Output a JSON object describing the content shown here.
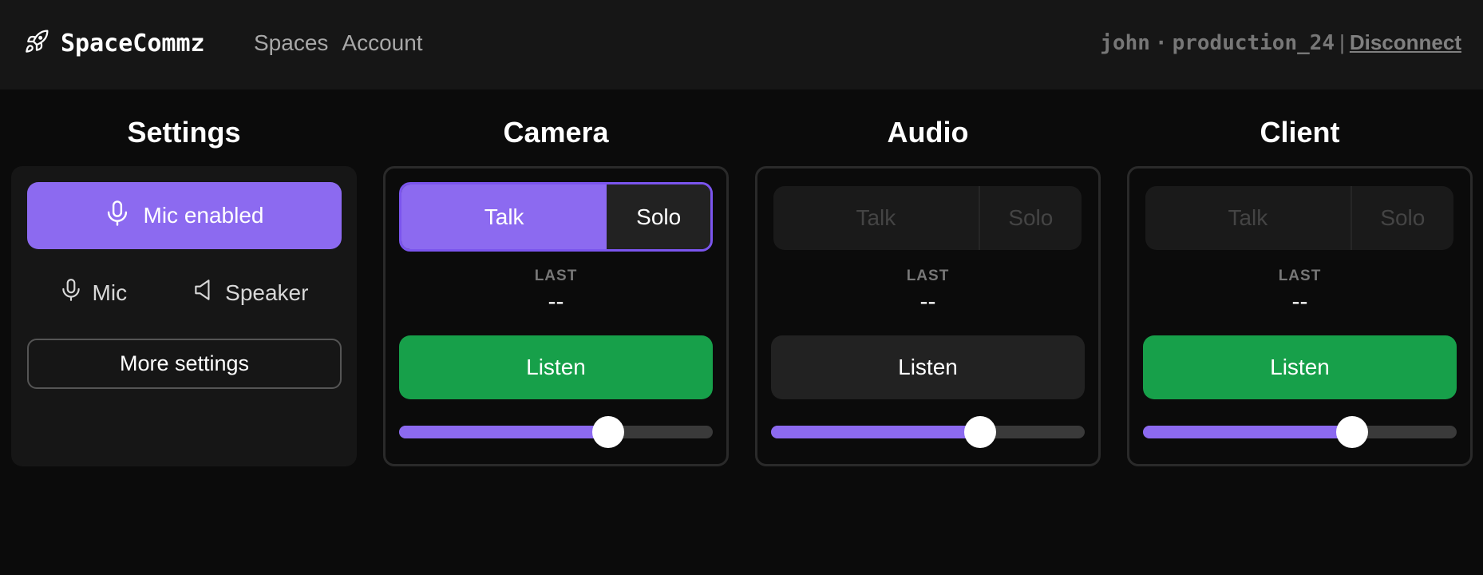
{
  "header": {
    "brand": "SpaceCommz",
    "nav": [
      "Spaces",
      "Account"
    ],
    "user": "john",
    "separator_dot": "·",
    "space": "production_24",
    "divider": "|",
    "disconnect_label": "Disconnect"
  },
  "settings": {
    "title": "Settings",
    "mic_enabled_label": "Mic enabled",
    "mic_label": "Mic",
    "speaker_label": "Speaker",
    "more_settings_label": "More settings"
  },
  "channels": [
    {
      "title": "Camera",
      "talk_label": "Talk",
      "solo_label": "Solo",
      "talk_active": true,
      "last_label": "LAST",
      "last_value": "--",
      "listen_label": "Listen",
      "listening": true,
      "volume": 0.667
    },
    {
      "title": "Audio",
      "talk_label": "Talk",
      "solo_label": "Solo",
      "talk_active": false,
      "last_label": "LAST",
      "last_value": "--",
      "listen_label": "Listen",
      "listening": false,
      "volume": 0.667
    },
    {
      "title": "Client",
      "talk_label": "Talk",
      "solo_label": "Solo",
      "talk_active": false,
      "last_label": "LAST",
      "last_value": "--",
      "listen_label": "Listen",
      "listening": true,
      "volume": 0.667
    }
  ],
  "colors": {
    "accent": "#8c6af0",
    "listen_on": "#17a04a",
    "listen_off": "#222222",
    "header_bg": "#161616",
    "page_bg": "#0b0b0b"
  }
}
